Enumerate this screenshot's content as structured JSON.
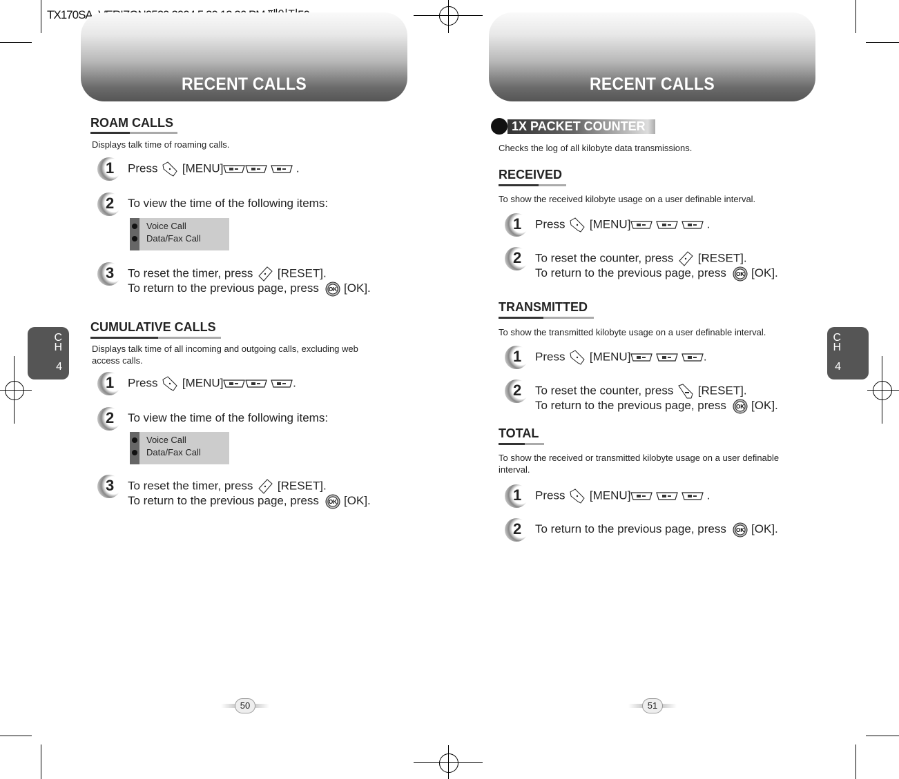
{
  "slug": "TX170SA_VERIZON0529 2004.5.29 12:26 PM 페이지50",
  "left": {
    "header": "RECENT CALLS",
    "chapter": {
      "c": "C",
      "h": "H",
      "n": "4"
    },
    "page_number": "50",
    "roam": {
      "title": "ROAM CALLS",
      "desc": "Displays talk time of roaming calls.",
      "steps": [
        {
          "num": "1",
          "lines": [
            [
              {
                "t": "Press "
              },
              {
                "icon": "end-key"
              },
              {
                "t": " [MENU]"
              },
              {
                "icon": "number-key"
              },
              {
                "icon": "number-key"
              },
              {
                "t": " "
              },
              {
                "icon": "number-key"
              },
              {
                "t": " ."
              }
            ]
          ]
        },
        {
          "num": "2",
          "lines": [
            [
              {
                "t": "To view the time of the following items:"
              }
            ]
          ]
        },
        {
          "num": "3",
          "lines": [
            [
              {
                "t": "To reset the timer, press "
              },
              {
                "icon": "soft-key"
              },
              {
                "t": " [RESET]."
              }
            ],
            [
              {
                "t": "To return to the previous page, press  "
              },
              {
                "icon": "ok-key"
              },
              {
                "t": " [OK]."
              }
            ]
          ]
        }
      ],
      "items": [
        "Voice Call",
        "Data/Fax Call"
      ]
    },
    "cumulative": {
      "title": "CUMULATIVE CALLS",
      "desc": [
        "Displays talk time of all incoming and outgoing calls, excluding web",
        "access calls."
      ],
      "steps": [
        {
          "num": "1",
          "lines": [
            [
              {
                "t": "Press "
              },
              {
                "icon": "end-key"
              },
              {
                "t": " [MENU]"
              },
              {
                "icon": "number-key"
              },
              {
                "icon": "number-key"
              },
              {
                "t": " "
              },
              {
                "icon": "number-key"
              },
              {
                "t": "."
              }
            ]
          ]
        },
        {
          "num": "2",
          "lines": [
            [
              {
                "t": "To view the time of the following items:"
              }
            ]
          ]
        },
        {
          "num": "3",
          "lines": [
            [
              {
                "t": "To reset the timer, press "
              },
              {
                "icon": "soft-key"
              },
              {
                "t": " [RESET]."
              }
            ],
            [
              {
                "t": "To return to the previous page, press  "
              },
              {
                "icon": "ok-key"
              },
              {
                "t": " [OK]."
              }
            ]
          ]
        }
      ],
      "items": [
        "Voice Call",
        "Data/Fax Call"
      ]
    }
  },
  "right": {
    "header": "RECENT CALLS",
    "chapter": {
      "c": "C",
      "h": "H",
      "n": "4"
    },
    "page_number": "51",
    "banner": "1X PACKET COUNTER",
    "banner_desc": "Checks the log of all kilobyte data transmissions.",
    "received": {
      "title": "RECEIVED",
      "desc": "To show the received kilobyte usage on a user definable interval.",
      "steps": [
        {
          "num": "1",
          "lines": [
            [
              {
                "t": "Press "
              },
              {
                "icon": "end-key"
              },
              {
                "t": " [MENU]"
              },
              {
                "icon": "number-key"
              },
              {
                "t": " "
              },
              {
                "icon": "number-key"
              },
              {
                "t": " "
              },
              {
                "icon": "number-key"
              },
              {
                "t": " ."
              }
            ]
          ]
        },
        {
          "num": "2",
          "lines": [
            [
              {
                "t": "To reset the counter, press "
              },
              {
                "icon": "soft-key"
              },
              {
                "t": " [RESET]."
              }
            ],
            [
              {
                "t": "To return to the previous page, press  "
              },
              {
                "icon": "ok-key"
              },
              {
                "t": " [OK]."
              }
            ]
          ]
        }
      ]
    },
    "transmitted": {
      "title": "TRANSMITTED",
      "desc": "To show the transmitted kilobyte usage on a user definable interval.",
      "steps": [
        {
          "num": "1",
          "lines": [
            [
              {
                "t": "Press "
              },
              {
                "icon": "end-key"
              },
              {
                "t": " [MENU]"
              },
              {
                "icon": "number-key"
              },
              {
                "t": " "
              },
              {
                "icon": "number-key"
              },
              {
                "t": " "
              },
              {
                "icon": "number-key"
              },
              {
                "t": "."
              }
            ]
          ]
        },
        {
          "num": "2",
          "lines": [
            [
              {
                "t": "To reset the counter, press "
              },
              {
                "icon": "clear-key"
              },
              {
                "t": " [RESET]."
              }
            ],
            [
              {
                "t": "To return to the previous page, press  "
              },
              {
                "icon": "ok-key"
              },
              {
                "t": " [OK]."
              }
            ]
          ]
        }
      ]
    },
    "total": {
      "title": "TOTAL",
      "desc": [
        "To show the received or transmitted kilobyte usage on a user definable",
        "interval."
      ],
      "steps": [
        {
          "num": "1",
          "lines": [
            [
              {
                "t": "Press "
              },
              {
                "icon": "end-key"
              },
              {
                "t": " [MENU]"
              },
              {
                "icon": "number-key"
              },
              {
                "t": " "
              },
              {
                "icon": "number-key"
              },
              {
                "t": " "
              },
              {
                "icon": "number-key"
              },
              {
                "t": " ."
              }
            ]
          ]
        },
        {
          "num": "2",
          "lines": [
            [
              {
                "t": "To return to the previous page, press  "
              },
              {
                "icon": "ok-key"
              },
              {
                "t": " [OK]."
              }
            ]
          ]
        }
      ]
    }
  }
}
